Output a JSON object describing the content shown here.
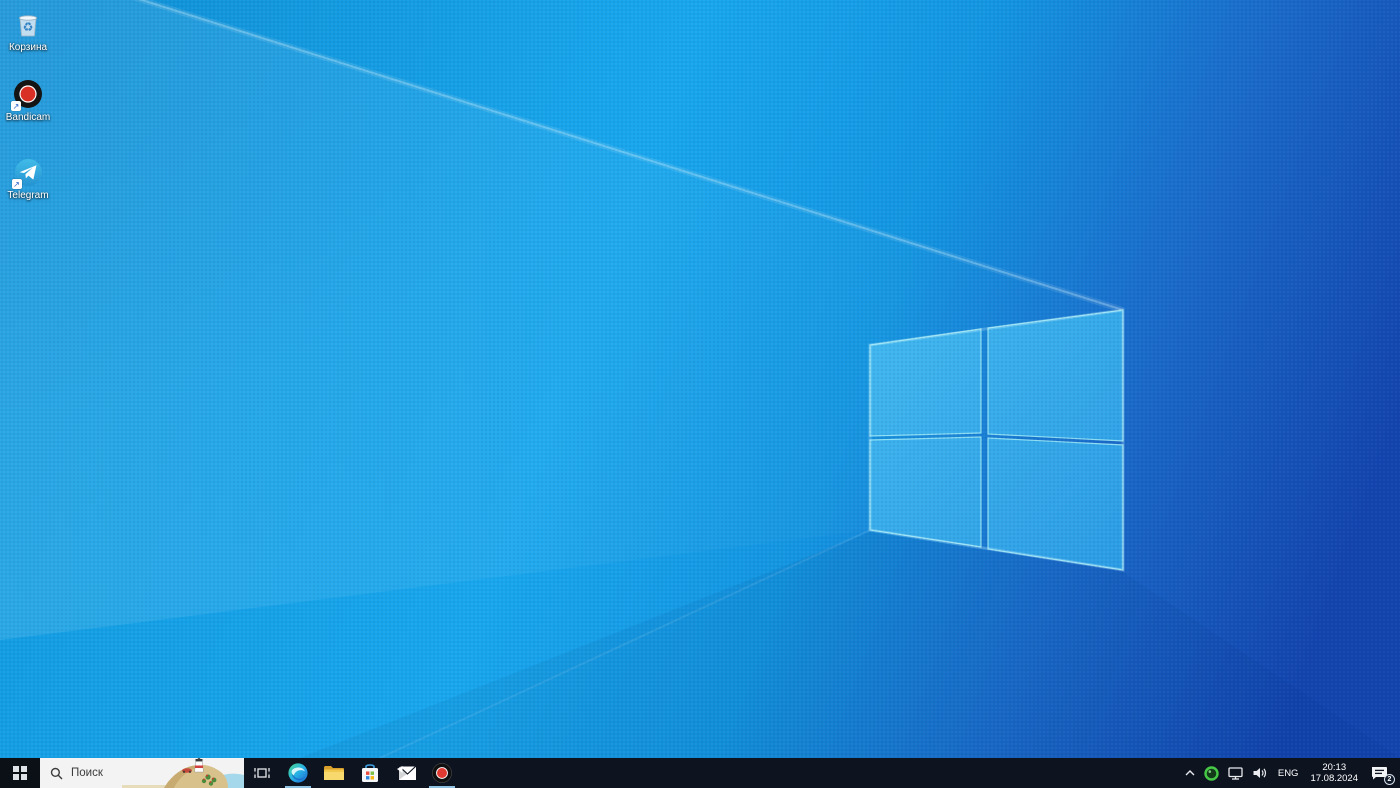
{
  "desktop": {
    "icons": [
      {
        "name": "recycle-bin",
        "label": "Корзина",
        "has_shortcut_arrow": false
      },
      {
        "name": "bandicam-shortcut",
        "label": "Bandicam",
        "has_shortcut_arrow": true
      },
      {
        "name": "telegram-shortcut",
        "label": "Telegram",
        "has_shortcut_arrow": true
      }
    ]
  },
  "taskbar": {
    "search": {
      "placeholder": "Поиск"
    },
    "apps": [
      {
        "name": "task-view"
      },
      {
        "name": "edge",
        "running": true
      },
      {
        "name": "file-explorer",
        "running": false
      },
      {
        "name": "microsoft-store",
        "running": false
      },
      {
        "name": "mail",
        "running": false
      },
      {
        "name": "bandicam",
        "running": true
      }
    ],
    "tray": {
      "language": "ENG",
      "clock": {
        "time": "20:13",
        "date": "17.08.2024"
      },
      "notifications": {
        "count": "2"
      },
      "icons": [
        "hidden-icons-chevron",
        "bandicam-tray",
        "network",
        "volume",
        "action-center"
      ]
    }
  },
  "colors": {
    "taskbar_bg": "#0d1420",
    "search_bg": "#f3f3f3",
    "wallpaper_bright": "#19a7ec",
    "wallpaper_dark": "#1445b2",
    "logo_pane": "#35adeb",
    "running_underline": "#8fc1e0",
    "bandicam_red": "#d93025",
    "telegram_blue": "#32a8dc",
    "tray_record_green": "#46c846"
  }
}
